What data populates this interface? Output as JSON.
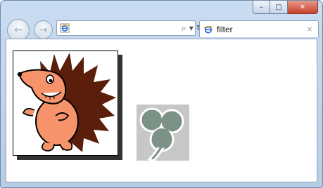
{
  "window": {
    "controls": {
      "minimize": "–",
      "maximize": "□",
      "close": "✕"
    }
  },
  "nav": {
    "back_icon": "back-arrow-icon",
    "forward_icon": "forward-arrow-icon",
    "back_glyph": "←",
    "forward_glyph": "→"
  },
  "address_bar": {
    "value": "",
    "placeholder": "",
    "tools": {
      "search": "⌕",
      "dropdown": "▾",
      "refresh": "↻",
      "stop": "✕"
    }
  },
  "tabs": [
    {
      "title": "filter",
      "close": "×"
    }
  ],
  "content": {
    "images": [
      {
        "name": "hedgehog cartoon image"
      },
      {
        "name": "clover image"
      }
    ]
  },
  "colors": {
    "accent": "#2a6fd0",
    "clover": "#7d9286",
    "clover_bg": "#c7c7c7",
    "hedgehog_spikes": "#5a1e0a",
    "hedgehog_body": "#f7936a"
  }
}
